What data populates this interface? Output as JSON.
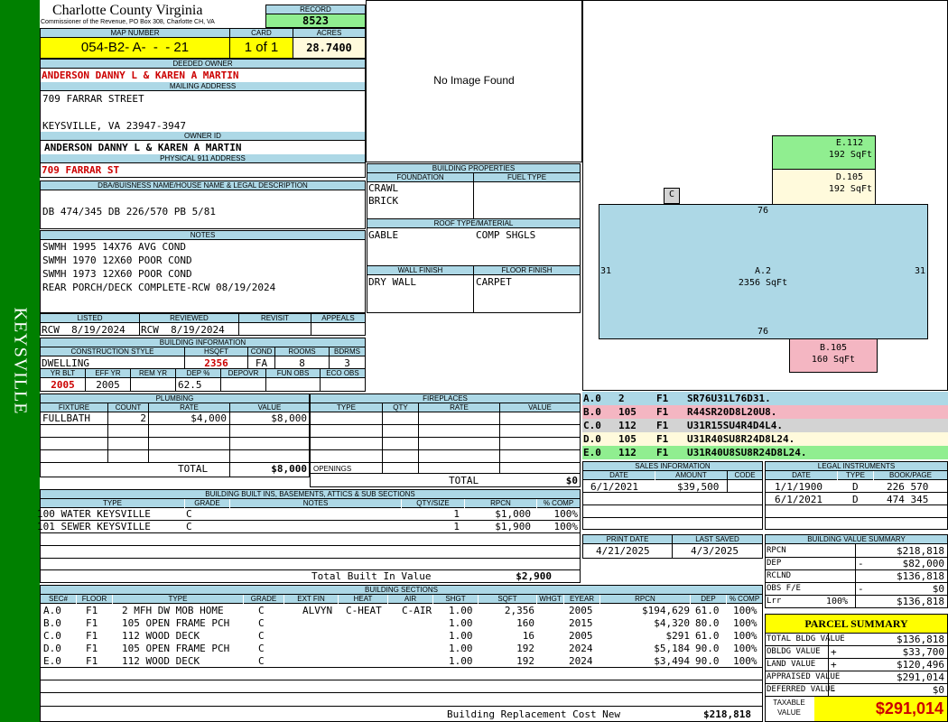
{
  "side_label": "KEYSVILLE",
  "county": "Charlotte County Virginia",
  "commissioner": "Commissioner of the Revenue, PO Box 308, Charlotte CH, VA",
  "record": {
    "label": "RECORD",
    "value": "8523"
  },
  "map": {
    "label": "MAP NUMBER",
    "value": "054-B2- A-  -  - 21"
  },
  "card": {
    "label": "CARD",
    "value": "1 of 1"
  },
  "acres": {
    "label": "ACRES",
    "value": "28.7400"
  },
  "deeded_owner": {
    "label": "DEEDED OWNER",
    "value": "ANDERSON DANNY L & KAREN A MARTIN"
  },
  "mailing": {
    "label": "MAILING ADDRESS",
    "line1": "709 FARRAR STREET",
    "line2": "KEYSVILLE, VA 23947-3947"
  },
  "owner_id": {
    "label": "OWNER ID",
    "value": "ANDERSON DANNY L & KAREN A MARTIN"
  },
  "physical": {
    "label": "PHYSICAL 911 ADDRESS",
    "value": "709 FARRAR ST"
  },
  "dba": {
    "label": "DBA/BUISNESS NAME/HOUSE NAME & LEGAL DESCRIPTION",
    "value": "DB 474/345 DB 226/570 PB 5/81"
  },
  "notes": {
    "label": "NOTES",
    "lines": [
      "SWMH 1995 14X76 AVG COND",
      "SWMH 1970 12X60 POOR COND",
      "SWMH 1973 12X60 POOR COND",
      "REAR PORCH/DECK COMPLETE-RCW 08/19/2024"
    ]
  },
  "review": {
    "listed_label": "LISTED",
    "listed": "RCW  8/19/2024",
    "reviewed_label": "REVIEWED",
    "reviewed": "RCW  8/19/2024",
    "revisit_label": "REVISIT",
    "appeals_label": "APPEALS"
  },
  "building_info": {
    "label": "BUILDING INFORMATION",
    "construction_label": "CONSTRUCTION STYLE",
    "construction": "DWELLING",
    "hsqft_label": "HSQFT",
    "hsqft": "2356",
    "cond_label": "COND",
    "cond": "FA",
    "rooms_label": "ROOMS",
    "rooms": "8",
    "bdrms_label": "BDRMS",
    "bdrms": "3",
    "yrblt_label": "YR BLT",
    "yrblt": "2005",
    "effyr_label": "EFF YR",
    "effyr": "2005",
    "remyr_label": "REM YR",
    "deppct_label": "DEP %",
    "deppct": "62.5",
    "depovr_label": "DEPOVR",
    "funobs_label": "FUN OBS",
    "ecoobs_label": "ECO OBS"
  },
  "photo_text": "No Image Found",
  "bldg_props": {
    "label": "BUILDING PROPERTIES",
    "foundation_label": "FOUNDATION",
    "foundation1": "CRAWL",
    "foundation2": "BRICK",
    "fuel_label": "FUEL TYPE",
    "roof_label": "ROOF TYPE/MATERIAL",
    "roof1": "GABLE",
    "roof2": "COMP SHGLS",
    "wall_label": "WALL FINISH",
    "wall": "DRY WALL",
    "floor_label": "FLOOR FINISH",
    "floor": "CARPET"
  },
  "sketch": {
    "a": {
      "name": "A.2",
      "area": "2356 SqFt",
      "top": "76",
      "bottom": "76",
      "left": "31",
      "right": "31"
    },
    "b": {
      "name": "B.105",
      "area": "160 SqFt"
    },
    "c": {
      "name": "C"
    },
    "d": {
      "name": "D.105",
      "area": "192 SqFt"
    },
    "e": {
      "name": "E.112",
      "area": "192 SqFt"
    },
    "colors": {
      "a": "#add8e6",
      "b": "#f4b6c2",
      "c": "#d3d3d3",
      "d": "#fffadc",
      "e": "#90ee90"
    }
  },
  "sketch_codes": [
    {
      "sec": "A.0",
      "num": "2",
      "fl": "F1",
      "code": "SR76U31L76D31."
    },
    {
      "sec": "B.0",
      "num": "105",
      "fl": "F1",
      "code": "R44SR20D8L20U8."
    },
    {
      "sec": "C.0",
      "num": "112",
      "fl": "F1",
      "code": "U31R15SU4R4D4L4."
    },
    {
      "sec": "D.0",
      "num": "105",
      "fl": "F1",
      "code": "U31R40SU8R24D8L24."
    },
    {
      "sec": "E.0",
      "num": "112",
      "fl": "F1",
      "code": "U31R40U8SU8R24D8L24."
    }
  ],
  "plumbing": {
    "label": "PLUMBING",
    "h_fixture": "FIXTURE",
    "h_count": "COUNT",
    "h_rate": "RATE",
    "h_value": "VALUE",
    "fixture": "FULLBATH",
    "count": "2",
    "rate": "$4,000",
    "value": "$8,000",
    "total_label": "TOTAL",
    "total": "$8,000"
  },
  "fireplaces": {
    "label": "FIREPLACES",
    "h_type": "TYPE",
    "h_qty": "QTY",
    "h_rate": "RATE",
    "h_value": "VALUE",
    "openings": "OPENINGS",
    "total_label": "TOTAL",
    "total": "$0"
  },
  "builtins": {
    "label": "BUILDING BUILT INS, BASEMENTS, ATTICS & SUB SECTIONS",
    "h_type": "TYPE",
    "h_grade": "GRADE",
    "h_notes": "NOTES",
    "h_qty": "QTY/SIZE",
    "h_rpcn": "RPCN",
    "h_comp": "% COMP",
    "rows": [
      {
        "type": "100 WATER KEYSVILLE",
        "grade": "C",
        "qty": "1",
        "rpcn": "$1,000",
        "comp": "100%"
      },
      {
        "type": "101 SEWER KEYSVILLE",
        "grade": "C",
        "qty": "1",
        "rpcn": "$1,900",
        "comp": "100%"
      }
    ],
    "total_label": "Total Built In Value",
    "total": "$2,900"
  },
  "sales": {
    "label": "SALES INFORMATION",
    "h_date": "DATE",
    "h_amount": "AMOUNT",
    "h_code": "CODE",
    "date": "6/1/2021",
    "amount": "$39,500"
  },
  "legal": {
    "label": "LEGAL INSTRUMENTS",
    "h_date": "DATE",
    "h_type": "TYPE",
    "h_book": "BOOK/PAGE",
    "rows": [
      {
        "date": "1/1/1900",
        "type": "D",
        "book": "226 570"
      },
      {
        "date": "6/1/2021",
        "type": "D",
        "book": "474 345"
      }
    ]
  },
  "print": {
    "print_label": "PRINT DATE",
    "print_date": "4/21/2025",
    "saved_label": "LAST SAVED",
    "saved_date": "4/3/2025"
  },
  "value_summary": {
    "label": "BUILDING VALUE SUMMARY",
    "rows": [
      {
        "k": "RPCN",
        "sign": "",
        "v": "$218,818"
      },
      {
        "k": "DEP",
        "sign": "-",
        "v": "$82,000"
      },
      {
        "k": "RCLND",
        "sign": "",
        "v": "$136,818"
      },
      {
        "k": "OBS F/E",
        "sign": "-",
        "v": "$0"
      },
      {
        "k": "Lrr",
        "pct": "100%",
        "sign": "",
        "v": "$136,818"
      }
    ]
  },
  "parcel": {
    "label": "PARCEL SUMMARY",
    "rows": [
      {
        "k": "TOTAL BLDG VALUE",
        "sign": "",
        "v": "$136,818"
      },
      {
        "k": "OBLDG VALUE",
        "sign": "+",
        "v": "$33,700"
      },
      {
        "k": "LAND VALUE",
        "sign": "+",
        "v": "$120,496"
      },
      {
        "k": "APPRAISED VALUE",
        "sign": "",
        "v": "$291,014"
      },
      {
        "k": "DEFERRED VALUE",
        "sign": "-",
        "v": "$0"
      }
    ],
    "taxable_label1": "TAXABLE",
    "taxable_label2": "VALUE",
    "taxable": "$291,014"
  },
  "sections": {
    "label": "BUILDING SECTIONS",
    "headers": [
      "SEC#",
      "FLOOR",
      "TYPE",
      "GRADE",
      "EXT FIN",
      "HEAT",
      "AIR",
      "SHGT",
      "SQFT",
      "WHGT",
      "EYEAR",
      "RPCN",
      "DEP",
      "% COMP"
    ],
    "rows": [
      {
        "sec": "A.0",
        "floor": "F1",
        "type": "2 MFH DW MOB HOME",
        "grade": "C",
        "ext": "ALVYN",
        "heat": "C-HEAT",
        "air": "C-AIR",
        "shgt": "1.00",
        "sqft": "2,356",
        "eyear": "2005",
        "rpcn": "$194,629",
        "dep": "61.0",
        "comp": "100%"
      },
      {
        "sec": "B.0",
        "floor": "F1",
        "type": "105 OPEN FRAME PCH",
        "grade": "C",
        "ext": "",
        "heat": "",
        "air": "",
        "shgt": "1.00",
        "sqft": "160",
        "eyear": "2015",
        "rpcn": "$4,320",
        "dep": "80.0",
        "comp": "100%"
      },
      {
        "sec": "C.0",
        "floor": "F1",
        "type": "112 WOOD DECK",
        "grade": "C",
        "ext": "",
        "heat": "",
        "air": "",
        "shgt": "1.00",
        "sqft": "16",
        "eyear": "2005",
        "rpcn": "$291",
        "dep": "61.0",
        "comp": "100%"
      },
      {
        "sec": "D.0",
        "floor": "F1",
        "type": "105 OPEN FRAME PCH",
        "grade": "C",
        "ext": "",
        "heat": "",
        "air": "",
        "shgt": "1.00",
        "sqft": "192",
        "eyear": "2024",
        "rpcn": "$5,184",
        "dep": "90.0",
        "comp": "100%"
      },
      {
        "sec": "E.0",
        "floor": "F1",
        "type": "112 WOOD DECK",
        "grade": "C",
        "ext": "",
        "heat": "",
        "air": "",
        "shgt": "1.00",
        "sqft": "192",
        "eyear": "2024",
        "rpcn": "$3,494",
        "dep": "90.0",
        "comp": "100%"
      }
    ],
    "total_label": "Building Replacement Cost New",
    "total": "$218,818"
  }
}
